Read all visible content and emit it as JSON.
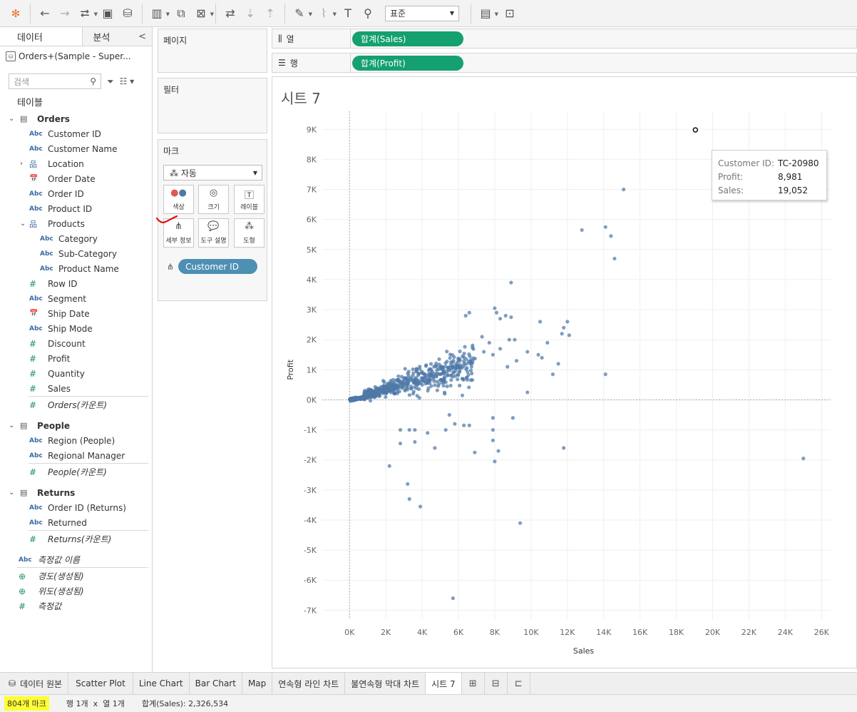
{
  "toolbar": {
    "buttons": [
      "tableau-logo-icon",
      "undo-icon",
      "redo-icon",
      "redo-options-icon",
      "save-icon",
      "new-datasource-icon",
      "new-worksheet-icon",
      "duplicate-sheet-icon",
      "clear-sheet-icon",
      "swap-icon",
      "sort-ascending-icon",
      "sort-descending-icon",
      "highlight-icon",
      "paperclip-icon",
      "text-label-icon",
      "pin-icon"
    ],
    "view_size": "표준",
    "right_buttons": [
      "show-me-icon",
      "presentation-icon"
    ]
  },
  "data_pane": {
    "tab_data": "데이터",
    "tab_analysis": "분석",
    "tab_collapse": "<",
    "datasource": "Orders+(Sample - Super...",
    "search_placeholder": "검색",
    "tables_label": "테이블",
    "tables": [
      {
        "name": "Orders",
        "fields": [
          {
            "type": "Abc",
            "label": "Customer ID"
          },
          {
            "type": "Abc",
            "label": "Customer Name"
          },
          {
            "type": "hier",
            "label": "Location",
            "expandable": true
          },
          {
            "type": "date",
            "label": "Order Date"
          },
          {
            "type": "Abc",
            "label": "Order ID"
          },
          {
            "type": "Abc",
            "label": "Product ID"
          },
          {
            "type": "hier",
            "label": "Products",
            "expanded": true
          },
          {
            "type": "Abc",
            "label": "Category",
            "indent": true
          },
          {
            "type": "Abc",
            "label": "Sub-Category",
            "indent": true
          },
          {
            "type": "Abc",
            "label": "Product Name",
            "indent": true
          },
          {
            "type": "num",
            "label": "Row ID"
          },
          {
            "type": "Abc",
            "label": "Segment"
          },
          {
            "type": "date",
            "label": "Ship Date"
          },
          {
            "type": "Abc",
            "label": "Ship Mode"
          },
          {
            "type": "num",
            "label": "Discount"
          },
          {
            "type": "num",
            "label": "Profit"
          },
          {
            "type": "num",
            "label": "Quantity"
          },
          {
            "type": "num",
            "label": "Sales"
          },
          {
            "type": "num",
            "label": "Orders(카운트)",
            "italic": true
          }
        ]
      },
      {
        "name": "People",
        "fields": [
          {
            "type": "Abc",
            "label": "Region (People)"
          },
          {
            "type": "Abc",
            "label": "Regional Manager"
          },
          {
            "type": "num",
            "label": "People(카운트)",
            "italic": true
          }
        ]
      },
      {
        "name": "Returns",
        "fields": [
          {
            "type": "Abc",
            "label": "Order ID (Returns)"
          },
          {
            "type": "Abc",
            "label": "Returned"
          },
          {
            "type": "num",
            "label": "Returns(카운트)",
            "italic": true
          }
        ]
      }
    ],
    "extra_fields": [
      {
        "type": "Abc",
        "label": "측정값 이름"
      },
      {
        "type": "geo",
        "label": "경도(생성됨)"
      },
      {
        "type": "geo",
        "label": "위도(생성됨)"
      },
      {
        "type": "num",
        "label": "측정값"
      }
    ]
  },
  "pages": {
    "title": "페이지"
  },
  "filters": {
    "title": "필터"
  },
  "marks": {
    "title": "마크",
    "type": "자동",
    "buttons": [
      {
        "name": "color",
        "label": "색상"
      },
      {
        "name": "size",
        "label": "크기"
      },
      {
        "name": "label",
        "label": "레이블"
      },
      {
        "name": "detail",
        "label": "세부 정보"
      },
      {
        "name": "tooltip",
        "label": "도구 설명"
      },
      {
        "name": "shape",
        "label": "도형"
      }
    ],
    "detail_pill": "Customer ID"
  },
  "shelves": {
    "columns_label": "열",
    "columns_pill": "합계(Sales)",
    "rows_label": "행",
    "rows_pill": "합계(Profit)"
  },
  "sheet": {
    "title": "시트 7",
    "tooltip": {
      "rows": [
        {
          "k": "Customer ID:",
          "v": "TC-20980"
        },
        {
          "k": "Profit:",
          "v": "8,981"
        },
        {
          "k": "Sales:",
          "v": "19,052"
        }
      ]
    }
  },
  "chart_data": {
    "type": "scatter",
    "title": "",
    "xlabel": "Sales",
    "ylabel": "Profit",
    "xlim": [
      -1500,
      26500
    ],
    "ylim": [
      -7300,
      9600
    ],
    "x_ticks": [
      0,
      2000,
      4000,
      6000,
      8000,
      10000,
      12000,
      14000,
      16000,
      18000,
      20000,
      22000,
      24000,
      26000
    ],
    "x_tick_labels": [
      "0K",
      "2K",
      "4K",
      "6K",
      "8K",
      "10K",
      "12K",
      "14K",
      "16K",
      "18K",
      "20K",
      "22K",
      "24K",
      "26K"
    ],
    "y_ticks": [
      9000,
      8000,
      7000,
      6000,
      5000,
      4000,
      3000,
      2000,
      1000,
      0,
      -1000,
      -2000,
      -3000,
      -4000,
      -5000,
      -6000,
      -7000
    ],
    "y_tick_labels": [
      "9K",
      "8K",
      "7K",
      "6K",
      "5K",
      "4K",
      "3K",
      "2K",
      "1K",
      "0K",
      "-1K",
      "-2K",
      "-3K",
      "-4K",
      "-5K",
      "-6K",
      "-7K"
    ],
    "grid": true,
    "mark_color": "#4e79a7",
    "total_marks": 804,
    "highlighted_point": [
      19052,
      8981
    ],
    "outliers": [
      [
        25000,
        -1950
      ],
      [
        15100,
        7000
      ],
      [
        12800,
        5650
      ],
      [
        14100,
        5750
      ],
      [
        14400,
        5450
      ],
      [
        14600,
        4700
      ],
      [
        8900,
        3900
      ],
      [
        8000,
        3050
      ],
      [
        8100,
        2900
      ],
      [
        8300,
        2700
      ],
      [
        8600,
        2800
      ],
      [
        8900,
        2750
      ],
      [
        6600,
        2900
      ],
      [
        6400,
        2800
      ],
      [
        11800,
        2400
      ],
      [
        12000,
        2600
      ],
      [
        11700,
        2200
      ],
      [
        12100,
        2150
      ],
      [
        10500,
        2600
      ],
      [
        10900,
        1900
      ],
      [
        10400,
        1500
      ],
      [
        9800,
        1600
      ],
      [
        10600,
        1400
      ],
      [
        11200,
        850
      ],
      [
        11500,
        1200
      ],
      [
        14100,
        850
      ],
      [
        9800,
        250
      ],
      [
        5700,
        -6600
      ],
      [
        9400,
        -4100
      ],
      [
        3900,
        -3550
      ],
      [
        3300,
        -3300
      ],
      [
        3200,
        -2800
      ],
      [
        2200,
        -2200
      ],
      [
        8000,
        -2050
      ],
      [
        8200,
        -1700
      ],
      [
        6900,
        -1750
      ],
      [
        11800,
        -1600
      ],
      [
        7900,
        -1350
      ],
      [
        7900,
        -1000
      ],
      [
        7900,
        -600
      ],
      [
        9000,
        -600
      ],
      [
        6300,
        -850
      ],
      [
        6600,
        -850
      ],
      [
        4700,
        -1600
      ],
      [
        4300,
        -1100
      ],
      [
        3300,
        -1000
      ],
      [
        3600,
        -1000
      ],
      [
        3600,
        -1400
      ],
      [
        2800,
        -1000
      ],
      [
        2800,
        -1450
      ],
      [
        5300,
        -1000
      ],
      [
        5800,
        -800
      ],
      [
        5500,
        -500
      ],
      [
        7300,
        2100
      ],
      [
        7700,
        1900
      ],
      [
        7400,
        1600
      ],
      [
        7900,
        1500
      ],
      [
        8300,
        1700
      ],
      [
        8800,
        2000
      ],
      [
        9100,
        2000
      ],
      [
        9200,
        1300
      ],
      [
        8700,
        1100
      ]
    ],
    "cluster_seed": 7
  },
  "sheet_tabs": [
    "데이터 원본",
    "Scatter Plot",
    "Line Chart",
    "Bar Chart",
    "Map",
    "연속형 라인 차트",
    "불연속형 막대 차트",
    "시트 7"
  ],
  "status": {
    "marks": "804개 마크",
    "rows_cols": "행 1개  x  열 1개",
    "sum": "합계(Sales): 2,326,534"
  }
}
